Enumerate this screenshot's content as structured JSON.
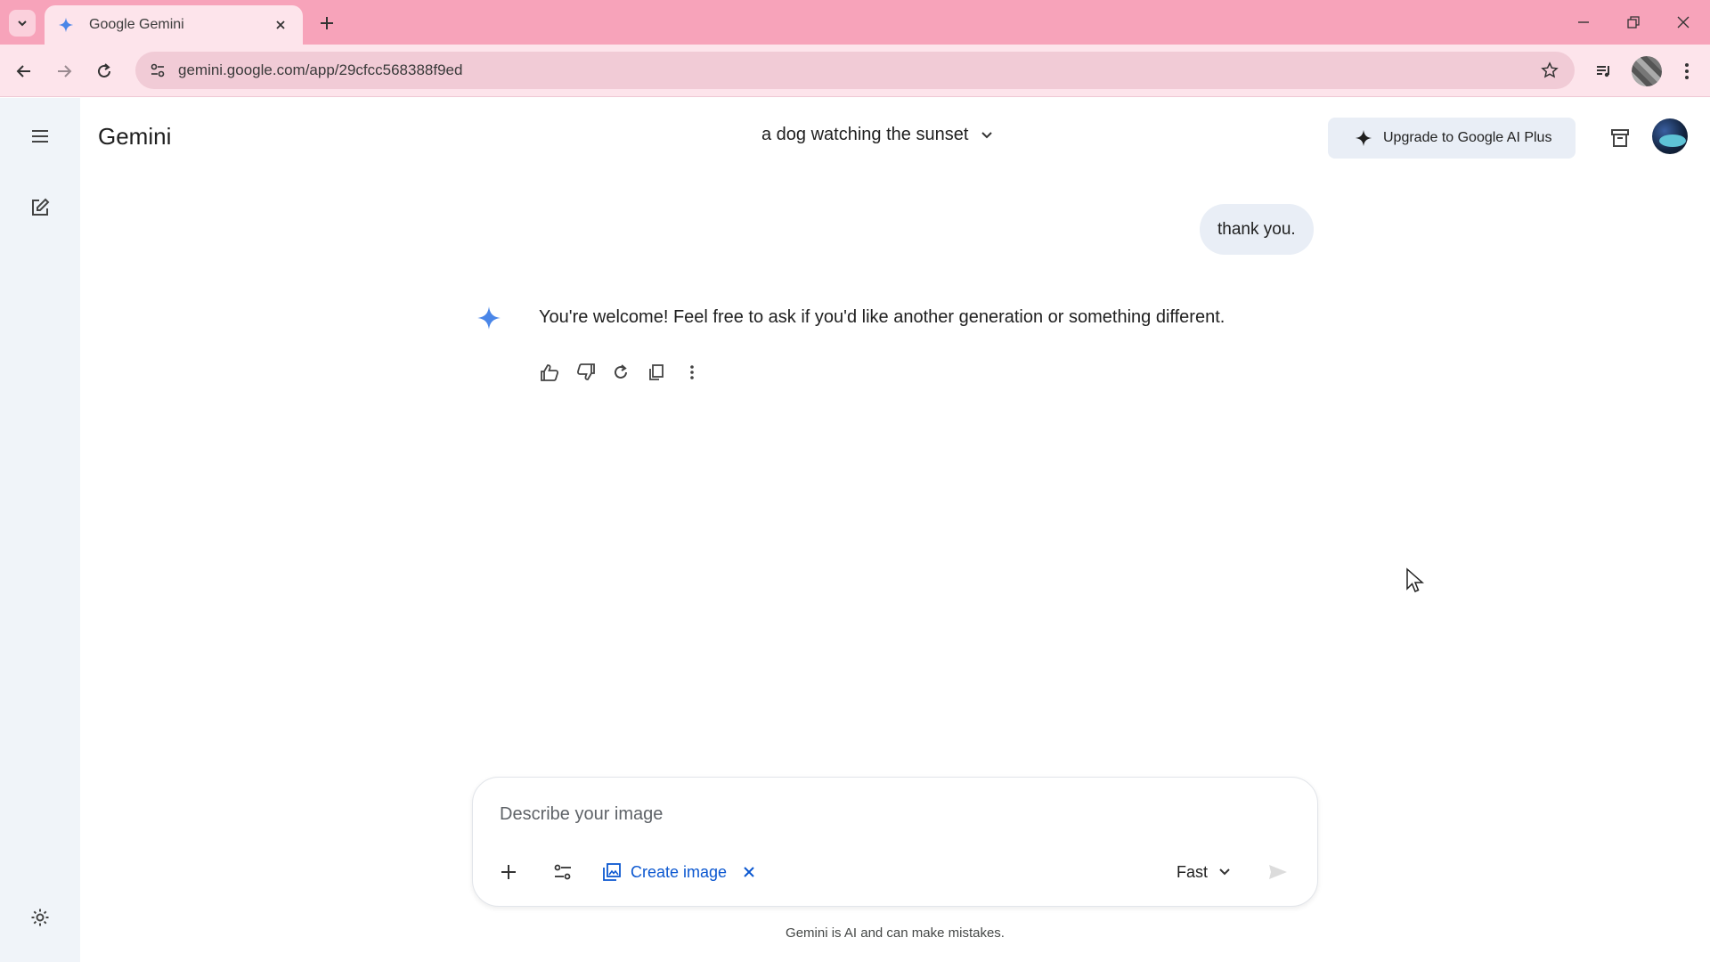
{
  "browser": {
    "tab_title": "Google Gemini",
    "url": "gemini.google.com/app/29cfcc568388f9ed"
  },
  "app": {
    "name": "Gemini",
    "chat_title": "a dog watching the sunset",
    "upgrade_label": "Upgrade to Google AI Plus"
  },
  "conversation": {
    "user_message": "thank you.",
    "model_message": "You're welcome! Feel free to ask if you'd like another generation or something different."
  },
  "composer": {
    "placeholder": "Describe your image",
    "tool_chip": "Create image",
    "model_mode": "Fast"
  },
  "footer": {
    "disclaimer": "Gemini is AI and can make mistakes."
  },
  "colors": {
    "tabbar": "#f7a3ba",
    "toolbar": "#fde4eb",
    "rail": "#f0f4f9",
    "accent": "#0b57d0",
    "bubble": "#e9eef6"
  }
}
